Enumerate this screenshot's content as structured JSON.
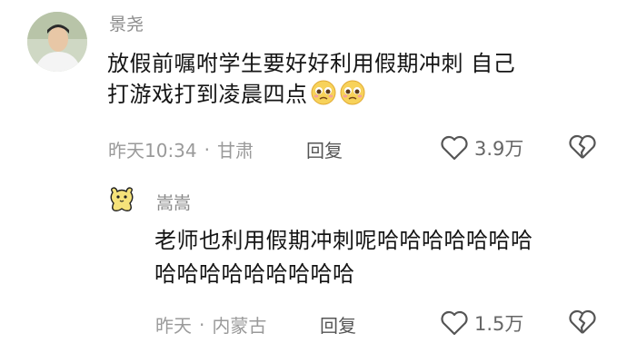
{
  "comments": [
    {
      "username": "景尧",
      "content_line1": "放假前嘱咐学生要好好利用假期冲刺  自己",
      "content_line2": "打游戏打到凌晨四点",
      "emoji": [
        "pleading-face-icon",
        "pleading-face-icon"
      ],
      "time": "昨天10:34",
      "location": "甘肃",
      "reply_label": "回复",
      "like_count": "3.9万"
    },
    {
      "username": "嵩嵩",
      "content_line1": "老师也利用假期冲刺呢哈哈哈哈哈哈哈",
      "content_line2": "哈哈哈哈哈哈哈哈哈",
      "time": "昨天",
      "location": "内蒙古",
      "reply_label": "回复",
      "like_count": "1.5万"
    }
  ],
  "separator": "·"
}
